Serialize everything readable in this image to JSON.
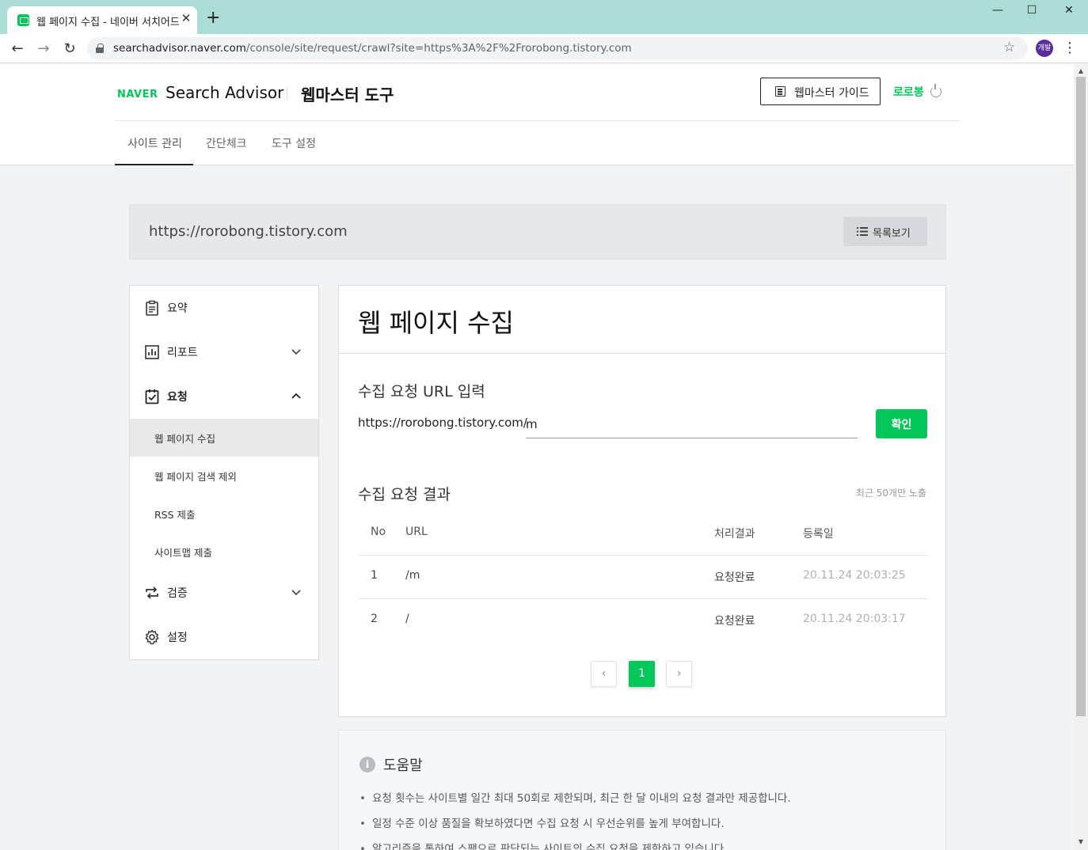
{
  "browser": {
    "tab_title": "웹 페이지 수집 - 네이버 서치어드바이저",
    "new_tab": "+",
    "url_host": "searchadvisor.naver.com",
    "url_path": "/console/site/request/crawl?site=https%3A%2F%2Frorobong.tistory.com",
    "profile_label": "개발"
  },
  "header": {
    "brand_logo": "NAVER",
    "brand_name": "Search Advisor",
    "tool_name": "웹마스터 도구",
    "guide_button": "웹마스터 가이드",
    "user_name": "로로봉",
    "nav": [
      "사이트 관리",
      "간단체크",
      "도구 설정"
    ]
  },
  "site": {
    "url": "https://rorobong.tistory.com",
    "list_button": "목록보기"
  },
  "sidebar": {
    "items": [
      {
        "label": "요약",
        "icon": "clipboard-icon"
      },
      {
        "label": "리포트",
        "icon": "bar-chart-icon"
      },
      {
        "label": "요청",
        "icon": "check-clipboard-icon"
      },
      {
        "label": "검증",
        "icon": "repeat-icon"
      },
      {
        "label": "설정",
        "icon": "gear-icon"
      }
    ],
    "sub_items": [
      "웹 페이지 수집",
      "웹 페이지 검색 제외",
      "RSS 제출",
      "사이트맵 제출"
    ]
  },
  "main": {
    "title": "웹 페이지 수집",
    "request_section_title": "수집 요청 URL 입력",
    "url_prefix": "https://rorobong.tistory.com/",
    "url_input_value": "m",
    "confirm_button": "확인",
    "result_section_title": "수집 요청 결과",
    "result_note": "최근 50개만 노출",
    "table": {
      "headers": [
        "No",
        "URL",
        "처리결과",
        "등록일"
      ],
      "rows": [
        {
          "no": "1",
          "url": "/m",
          "status": "요청완료",
          "date": "20.11.24 20:03:25"
        },
        {
          "no": "2",
          "url": "/",
          "status": "요청완료",
          "date": "20.11.24 20:03:17"
        }
      ]
    },
    "pagination": {
      "prev": "‹",
      "current": "1",
      "next": "›"
    }
  },
  "help": {
    "icon_label": "i",
    "title": "도움말",
    "items": [
      "요청 횟수는 사이트별 일간 최대 50회로 제한되며, 최근 한 달 이내의 요청 결과만 제공합니다.",
      "일정 수준 이상 품질을 확보하였다면 수집 요청 시 우선순위를 높게 부여합니다.",
      "알고리즘을 통하여 스팸으로 판단되는 사이트의 수집 요청을 제한하고 있습니다."
    ]
  },
  "colors": {
    "accent": "#03c75a",
    "tabstrip": "#acdcd6"
  }
}
